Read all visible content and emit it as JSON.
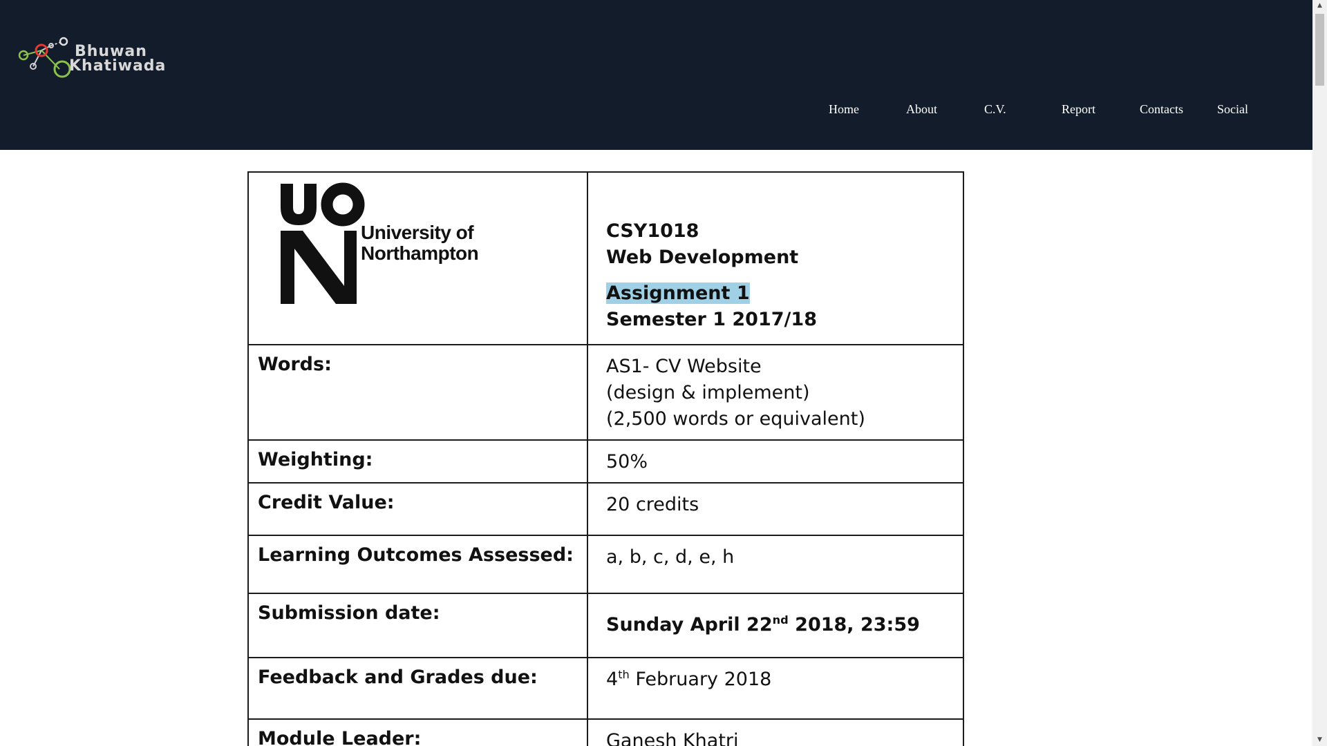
{
  "site": {
    "logo_name_line1": "Bhuwan",
    "logo_name_line2": "Khatiwada",
    "logo_icon": "molecule-network-icon",
    "nav": [
      "Home",
      "About",
      "C.V.",
      "Report",
      "Contacts",
      "Social"
    ],
    "colors": {
      "header_bg": "#131c2b",
      "nav_text": "#ffffff",
      "highlight": "#9fd0e6"
    }
  },
  "document": {
    "university_logo_text_line1": "University of",
    "university_logo_text_line2": "Northampton",
    "module_code": "CSY1018",
    "module_name": "Web Development",
    "assignment": "Assignment 1",
    "semester": "Semester 1 2017/18",
    "rows": [
      {
        "label": "Words:",
        "value_lines": [
          "AS1- CV Website",
          "(design & implement)",
          "(2,500 words or equivalent)"
        ]
      },
      {
        "label": "Weighting:",
        "value": "50%"
      },
      {
        "label": "Credit Value:",
        "value": "20 credits"
      },
      {
        "label": "Learning Outcomes Assessed:",
        "value": "a, b, c, d, e, h"
      },
      {
        "label": "Submission date:",
        "value_pre": "Sunday April 22",
        "value_sup": "nd",
        "value_post": " 2018, 23:59"
      },
      {
        "label": "Feedback and Grades due:",
        "value_pre": "4",
        "value_sup": "th",
        "value_post": " February 2018"
      },
      {
        "label": "Module Leader:",
        "value": "Ganesh Khatri"
      }
    ]
  }
}
